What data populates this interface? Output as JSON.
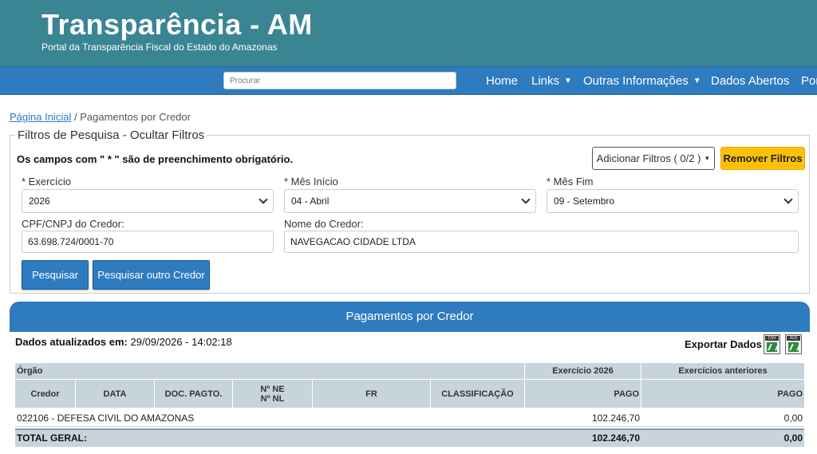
{
  "header": {
    "title": "Transparência - AM",
    "subtitle": "Portal da Transparência Fiscal do Estado do Amazonas"
  },
  "nav": {
    "search_placeholder": "Procurar",
    "items": [
      "Home",
      "Links",
      "Outras Informações",
      "Dados Abertos",
      "Por"
    ]
  },
  "breadcrumb": {
    "home": "Página Inicial",
    "separator": "/",
    "current": "Pagamentos por Credor"
  },
  "filters": {
    "legend": "Filtros de Pesquisa - Ocultar Filtros",
    "required_note": "Os campos com \" * \" são de preenchimento obrigatório.",
    "add_filters_label": "Adicionar Filtros ( 0/2 )",
    "remove_filters_label": "Remover Filtros",
    "exercicio": {
      "label": "* Exercício",
      "value": "2026"
    },
    "mes_inicio": {
      "label": "* Mês Início",
      "value": "04 - Abril"
    },
    "mes_fim": {
      "label": "* Mês Fim",
      "value": "09 - Setembro"
    },
    "cpf_cnpj": {
      "label": "CPF/CNPJ do Credor:",
      "value": "63.698.724/0001-70"
    },
    "nome_credor": {
      "label": "Nome do Credor:",
      "value": "NAVEGACAO CIDADE LTDA"
    },
    "search_button": "Pesquisar",
    "search_other_button": "Pesquisar outro Credor"
  },
  "results": {
    "panel_title": "Pagamentos por Credor",
    "updated_label": "Dados atualizados em:",
    "updated_value": "29/09/2026 - 14:02:18",
    "export_label": "Exportar Dados",
    "export_csv_tag": "CSV",
    "export_xls_tag": "XLS",
    "table": {
      "group_headers": {
        "orgao": "Órgão",
        "exercicio": "Exercício 2026",
        "anteriores": "Exercícios anteriores"
      },
      "columns": {
        "credor": "Credor",
        "data": "DATA",
        "doc_pagto": "DOC. PAGTO.",
        "ne": "Nº NE",
        "nl": "Nº NL",
        "fr": "FR",
        "classificacao": "CLASSIFICAÇÃO",
        "pago": "PAGO",
        "pago_ant": "PAGO"
      },
      "rows": [
        {
          "orgao": "022106 - DEFESA CIVIL DO AMAZONAS",
          "pago": "102.246,70",
          "pago_ant": "0,00"
        }
      ],
      "total": {
        "label": "TOTAL GERAL:",
        "pago": "102.246,70",
        "pago_ant": "0,00"
      }
    }
  },
  "colors": {
    "header_bg": "#3a8594",
    "nav_bg": "#2f7bbf",
    "accent_yellow": "#ffc107",
    "table_header_bg": "#c8d4db"
  }
}
